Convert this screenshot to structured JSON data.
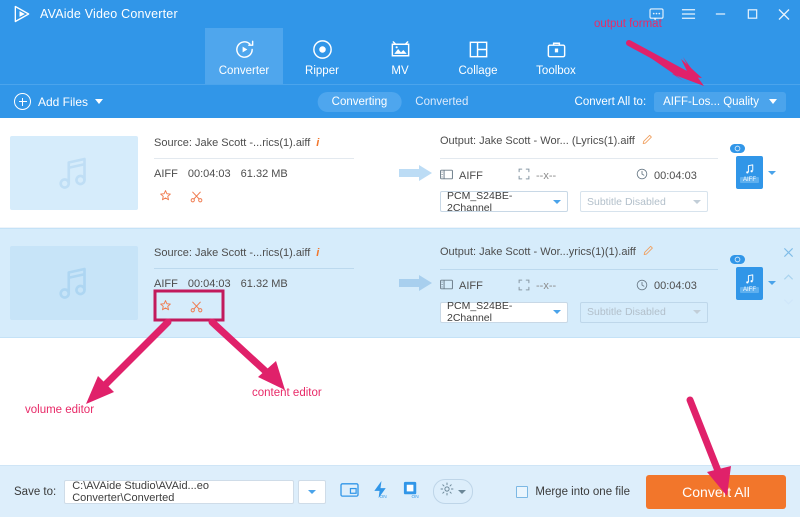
{
  "window": {
    "app_title": "AVAide Video Converter",
    "controls": [
      {
        "name": "feedback-icon",
        "label": "feedback"
      },
      {
        "name": "menu-icon",
        "label": "menu"
      },
      {
        "name": "minimize-icon",
        "label": "minimize"
      },
      {
        "name": "maximize-icon",
        "label": "maximize"
      },
      {
        "name": "close-icon",
        "label": "close"
      }
    ]
  },
  "nav": {
    "tabs": [
      {
        "label": "Converter",
        "icon": "converter-icon",
        "active": true
      },
      {
        "label": "Ripper",
        "icon": "ripper-icon",
        "active": false
      },
      {
        "label": "MV",
        "icon": "mv-icon",
        "active": false
      },
      {
        "label": "Collage",
        "icon": "collage-icon",
        "active": false
      },
      {
        "label": "Toolbox",
        "icon": "toolbox-icon",
        "active": false
      }
    ]
  },
  "subbar": {
    "add_files_label": "Add Files",
    "segment": [
      {
        "label": "Converting",
        "active": true
      },
      {
        "label": "Converted",
        "active": false
      }
    ],
    "convert_all_to_label": "Convert All to:",
    "convert_all_to_value": "AIFF-Los... Quality"
  },
  "files": [
    {
      "source_label": "Source: Jake Scott -...rics(1).aiff",
      "format": "AIFF",
      "duration": "00:04:03",
      "size": "61.32 MB",
      "output_label": "Output: Jake Scott - Wor... (Lyrics(1).aiff",
      "out_format": "AIFF",
      "out_resolution": "--x--",
      "out_duration": "00:04:03",
      "audio_codec": "PCM_S24BE-2Channel",
      "subtitle": "Subtitle Disabled",
      "badge": "AIFF",
      "selected": false
    },
    {
      "source_label": "Source: Jake Scott -...rics(1).aiff",
      "format": "AIFF",
      "duration": "00:04:03",
      "size": "61.32 MB",
      "output_label": "Output: Jake Scott - Wor...yrics(1)(1).aiff",
      "out_format": "AIFF",
      "out_resolution": "--x--",
      "out_duration": "00:04:03",
      "audio_codec": "PCM_S24BE-2Channel",
      "subtitle": "Subtitle Disabled",
      "badge": "AIFF",
      "selected": true
    }
  ],
  "bottom": {
    "save_to_label": "Save to:",
    "save_to_path": "C:\\AVAide Studio\\AVAid...eo Converter\\Converted",
    "merge_label": "Merge into one file",
    "merge_checked": false,
    "convert_all_label": "Convert All"
  },
  "annotations": [
    {
      "id": "output-format",
      "text": "output format"
    },
    {
      "id": "volume-editor",
      "text": "volume editor"
    },
    {
      "id": "content-editor",
      "text": "content editor"
    }
  ],
  "colors": {
    "header_blue": "#3196e8",
    "tab_active": "#4fa6ed",
    "selected_row": "#d6ecfb",
    "bottom_bar": "#ddeefb",
    "convert_orange": "#f2762b",
    "annotation_pink": "#e82a68",
    "edit_icon_orange": "#f07a4e"
  }
}
